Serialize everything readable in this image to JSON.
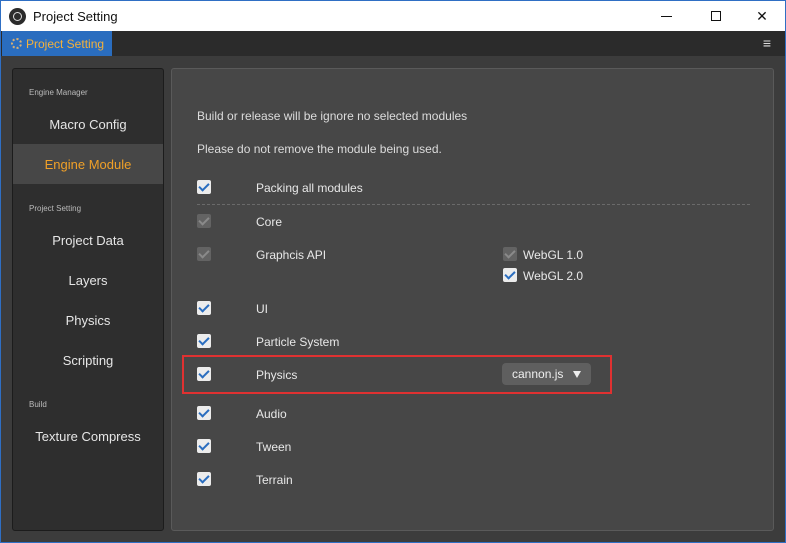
{
  "window": {
    "title": "Project Setting",
    "controls": [
      "minimize",
      "maximize",
      "close"
    ]
  },
  "tabbar": {
    "active_tab": "Project Setting",
    "menu_icon": "hamburger-icon"
  },
  "sidebar": {
    "sections": [
      {
        "label": "Engine Manager",
        "items": [
          "Macro Config",
          "Engine Module"
        ]
      },
      {
        "label": "Project Setting",
        "items": [
          "Project Data",
          "Layers",
          "Physics",
          "Scripting"
        ]
      },
      {
        "label": "Build",
        "items": [
          "Texture Compress"
        ]
      }
    ],
    "active_item": "Engine Module"
  },
  "content": {
    "info_lines": [
      "Build or release will be ignore no selected modules",
      "Please do not remove the module being used."
    ],
    "packing_all": {
      "label": "Packing all modules",
      "checked": true
    },
    "modules": [
      {
        "label": "Core",
        "checked": true,
        "disabled": true
      },
      {
        "label": "Graphcis API",
        "checked": true,
        "disabled": true,
        "options": [
          {
            "label": "WebGL 1.0",
            "checked": true,
            "disabled": true
          },
          {
            "label": "WebGL 2.0",
            "checked": true,
            "disabled": false
          }
        ]
      },
      {
        "label": "UI",
        "checked": true
      },
      {
        "label": "Particle System",
        "checked": true
      },
      {
        "label": "Physics",
        "checked": true,
        "select_value": "cannon.js",
        "highlighted": true
      },
      {
        "label": "Audio",
        "checked": true
      },
      {
        "label": "Tween",
        "checked": true
      },
      {
        "label": "Terrain",
        "checked": true
      }
    ]
  },
  "colors": {
    "accent": "#2a6dbf",
    "active_text": "#f0a028",
    "highlight_box": "#e03131"
  }
}
